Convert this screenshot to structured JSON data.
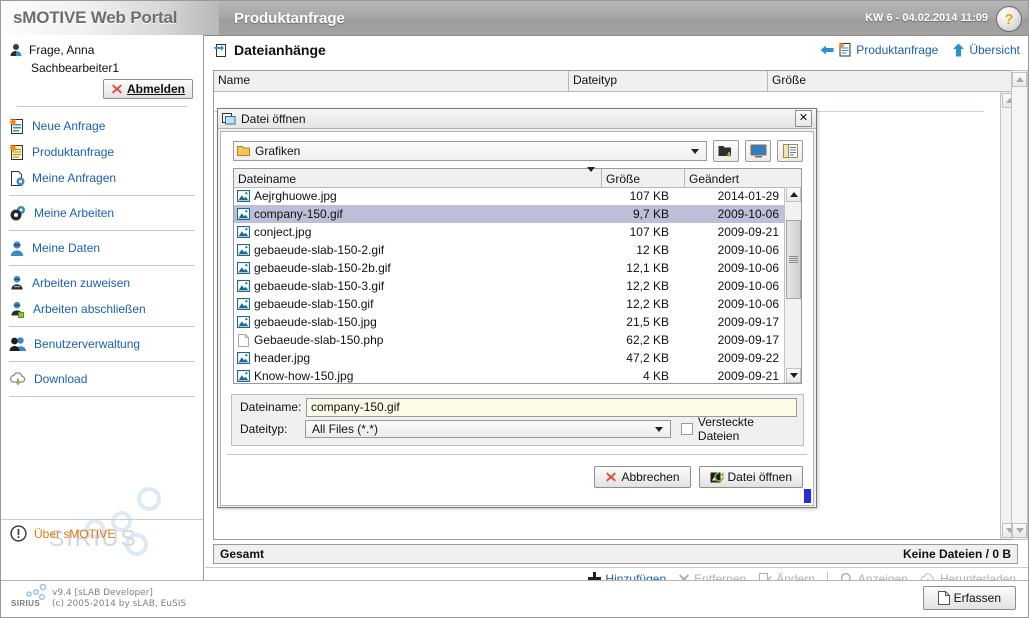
{
  "header": {
    "brand": "sMOTIVE Web Portal",
    "page_title": "Produktanfrage",
    "datetime": "KW 6 - 04.02.2014 11:09",
    "help_label": "?"
  },
  "sidebar": {
    "user_name": "Frage, Anna",
    "user_role": "Sachbearbeiter1",
    "logout_label": "Abmelden",
    "nav": [
      {
        "label": "Neue Anfrage",
        "icon": "new-request-icon"
      },
      {
        "label": "Produktanfrage",
        "icon": "product-request-icon"
      },
      {
        "label": "Meine Anfragen",
        "icon": "my-requests-icon"
      },
      {
        "label": "Meine Arbeiten",
        "icon": "gears-icon"
      },
      {
        "label": "Meine Daten",
        "icon": "user-data-icon"
      },
      {
        "label": "Arbeiten zuweisen",
        "icon": "assign-work-icon"
      },
      {
        "label": "Arbeiten abschließen",
        "icon": "complete-work-icon"
      },
      {
        "label": "Benutzerverwaltung",
        "icon": "users-icon"
      },
      {
        "label": "Download",
        "icon": "download-cloud-icon"
      }
    ],
    "watermark": "SIRIUS",
    "about_label": "Über sMOTIVE"
  },
  "footer": {
    "logo_text": "SIRIUS",
    "version_line1": "v9.4 [sLAB Developer]",
    "version_line2": "(c) 2005-2014 by sLAB, EuSIS",
    "submit_label": "Erfassen"
  },
  "main": {
    "title": "Dateianhänge",
    "breadcrumbs": [
      {
        "label": "Produktanfrage",
        "icon": "back-arrow-icon"
      },
      {
        "label": "Übersicht",
        "icon": "up-arrow-icon"
      }
    ],
    "table_headers": [
      "Name",
      "Dateityp",
      "Größe"
    ],
    "rows": [],
    "total_label": "Gesamt",
    "total_value": "Keine Dateien / 0 B",
    "actions": [
      {
        "label": "Hinzufügen",
        "icon": "plus-icon",
        "enabled": true
      },
      {
        "label": "Entfernen",
        "icon": "remove-x-icon",
        "enabled": false
      },
      {
        "label": "Ändern",
        "icon": "edit-icon",
        "enabled": false
      },
      {
        "label": "Anzeigen",
        "icon": "magnifier-icon",
        "enabled": false
      },
      {
        "label": "Herunterladen",
        "icon": "download-cloud-icon",
        "enabled": false
      }
    ]
  },
  "dialog": {
    "title": "Datei öffnen",
    "close_label": "✕",
    "current_folder": "Grafiken",
    "toolbar": [
      {
        "name": "new-folder-icon"
      },
      {
        "name": "desktop-icon"
      },
      {
        "name": "list-view-icon"
      }
    ],
    "columns": [
      "Dateiname",
      "Größe",
      "Geändert"
    ],
    "files": [
      {
        "name": "Aejrghuowe.jpg",
        "size": "107 KB",
        "modified": "2014-01-29",
        "type": "image",
        "selected": false
      },
      {
        "name": "company-150.gif",
        "size": "9,7 KB",
        "modified": "2009-10-06",
        "type": "image",
        "selected": true
      },
      {
        "name": "conject.jpg",
        "size": "107 KB",
        "modified": "2009-09-21",
        "type": "image",
        "selected": false
      },
      {
        "name": "gebaeude-slab-150-2.gif",
        "size": "12 KB",
        "modified": "2009-10-06",
        "type": "image",
        "selected": false
      },
      {
        "name": "gebaeude-slab-150-2b.gif",
        "size": "12,1 KB",
        "modified": "2009-10-06",
        "type": "image",
        "selected": false
      },
      {
        "name": "gebaeude-slab-150-3.gif",
        "size": "12,2 KB",
        "modified": "2009-10-06",
        "type": "image",
        "selected": false
      },
      {
        "name": "gebaeude-slab-150.gif",
        "size": "12,2 KB",
        "modified": "2009-10-06",
        "type": "image",
        "selected": false
      },
      {
        "name": "gebaeude-slab-150.jpg",
        "size": "21,5 KB",
        "modified": "2009-09-17",
        "type": "image",
        "selected": false
      },
      {
        "name": "Gebaeude-slab-150.php",
        "size": "62,2 KB",
        "modified": "2009-09-17",
        "type": "file",
        "selected": false
      },
      {
        "name": "header.jpg",
        "size": "47,2 KB",
        "modified": "2009-09-22",
        "type": "image",
        "selected": false
      },
      {
        "name": "Know-how-150.jpg",
        "size": "4 KB",
        "modified": "2009-09-21",
        "type": "image",
        "selected": false
      }
    ],
    "filename_label": "Dateiname:",
    "filename_value": "company-150.gif",
    "filetype_label": "Dateityp:",
    "filetype_value": "All Files (*.*)",
    "hidden_files_label": "Versteckte Dateien",
    "hidden_files_checked": false,
    "cancel_label": "Abbrechen",
    "open_label": "Datei öffnen"
  },
  "colors": {
    "link": "#1a5fb4",
    "accent_orange": "#e07b12",
    "selection": "#bdbed8",
    "header_gray": "#a2a2a2",
    "disabled": "#b0b0b0"
  }
}
